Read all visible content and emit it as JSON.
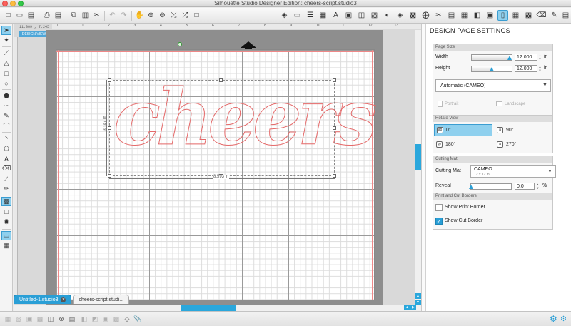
{
  "window": {
    "title": "Silhouette Studio Designer Edition: cheers-script.studio3"
  },
  "toolbar": {
    "left_icons": [
      "new-document-icon",
      "open-icon",
      "save-icon",
      "print-icon",
      "cut-to-printer-icon",
      "copy-icon",
      "paste-icon",
      "scissors-icon",
      "undo-icon",
      "redo-icon",
      "pan-icon",
      "zoom-in-icon",
      "zoom-out-icon",
      "zoom-select-icon",
      "zoom-fit-icon",
      "zoom-page-icon"
    ],
    "right_icons": [
      "fill-color-icon",
      "line-color-icon",
      "line-style-icon",
      "fill-pattern-icon",
      "text-style-icon",
      "transform-icon",
      "align-icon",
      "replicate-icon",
      "modify-icon",
      "offset-icon",
      "trace-icon",
      "page-settings-icon",
      "registration-icon",
      "cut-settings-icon",
      "store-icon",
      "library-icon",
      "eraser-icon",
      "cut-send-icon"
    ]
  },
  "left_tools": {
    "icons": [
      "select-icon",
      "point-edit-icon",
      "line-icon",
      "polygon-icon",
      "curve-icon",
      "rectangle-icon",
      "rounded-rect-icon",
      "ellipse-icon",
      "polygon-fill-icon",
      "freehand-icon",
      "smooth-freehand-icon",
      "pencil-icon",
      "arc-icon",
      "regular-polygon-icon",
      "text-icon",
      "eraser-tool-icon",
      "knife-icon",
      "eyedropper-icon",
      "cut-mat-icon",
      "text-to-path-icon",
      "fill-icon",
      "design-view-icon",
      "media-view-icon"
    ]
  },
  "workspace": {
    "coords_readout": "11.009 , 7.245",
    "design_view_label": "DESIGN VIEW",
    "ruler_ticks": [
      "0",
      "1",
      "2",
      "3",
      "4",
      "5",
      "6",
      "7",
      "8",
      "9",
      "10",
      "11",
      "12",
      "13"
    ],
    "design_text": "cheers",
    "width_dimension": "8.593 in",
    "height_dimension": "3.147 in"
  },
  "doc_tabs": [
    {
      "label": "Untitled-1.studio3",
      "active": true
    },
    {
      "label": "cheers-script.studi...",
      "active": false
    }
  ],
  "design_page_settings": {
    "title": "DESIGN PAGE SETTINGS",
    "page_size": {
      "header": "Page Size",
      "width_label": "Width",
      "width_value": "12.000",
      "width_unit": "in",
      "width_level": 0.95,
      "height_label": "Height",
      "height_value": "12.000",
      "height_unit": "in",
      "height_level": 0.5,
      "preset": "Automatic (CAMEO)",
      "portrait_label": "Portrait",
      "landscape_label": "Landscape"
    },
    "rotate_view": {
      "header": "Rotate View",
      "options": [
        "0°",
        "90°",
        "180°",
        "270°"
      ],
      "selected": "0°"
    },
    "cutting_mat": {
      "header": "Cutting Mat",
      "label": "Cutting Mat",
      "mat_name": "CAMEO",
      "mat_size": "12 x 12 in",
      "reveal_label": "Reveal",
      "reveal_value": "0.0",
      "reveal_unit": "%",
      "reveal_level": 0.0
    },
    "print_cut_borders": {
      "header": "Print and Cut Borders",
      "show_print_border_label": "Show Print Border",
      "show_print_border": false,
      "show_cut_border_label": "Show Cut Border",
      "show_cut_border": true
    }
  },
  "bottombar": {
    "icons": [
      "group-icon",
      "ungroup-icon",
      "delete-icon",
      "duplicate-icon",
      "select-all-icon",
      "deselect-icon",
      "bring-front-icon",
      "send-back-icon",
      "bring-forward-icon",
      "send-backward-icon",
      "make-compound-icon",
      "release-compound-icon",
      "weld-icon",
      "attach-icon"
    ]
  },
  "colors": {
    "accent": "#2a9fd6",
    "design_stroke": "#e46a6a",
    "mat": "#8e8e8e"
  }
}
